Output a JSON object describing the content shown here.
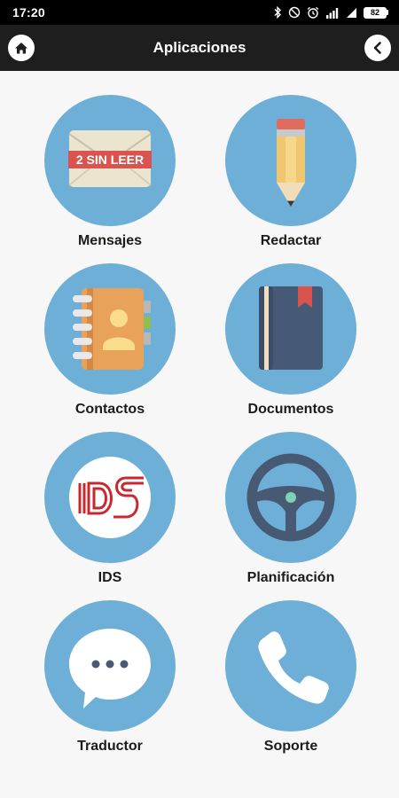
{
  "status_bar": {
    "time": "17:20",
    "battery": "82"
  },
  "app_bar": {
    "title": "Aplicaciones",
    "home_icon": "home-icon",
    "back_icon": "chevron-left-icon"
  },
  "colors": {
    "circle": "#6dafd6",
    "app_bar": "#1e1e1e",
    "background": "#f7f7f7"
  },
  "apps": [
    {
      "label": "Mensajes",
      "icon": "envelope-icon",
      "badge": "2 SIN LEER"
    },
    {
      "label": "Redactar",
      "icon": "pencil-icon"
    },
    {
      "label": "Contactos",
      "icon": "address-book-icon"
    },
    {
      "label": "Documentos",
      "icon": "notebook-icon"
    },
    {
      "label": "IDS",
      "icon": "ids-logo-icon",
      "logo_text": "IDS"
    },
    {
      "label": "Planificación",
      "icon": "steering-wheel-icon"
    },
    {
      "label": "Traductor",
      "icon": "chat-bubble-icon"
    },
    {
      "label": "Soporte",
      "icon": "phone-icon"
    }
  ]
}
